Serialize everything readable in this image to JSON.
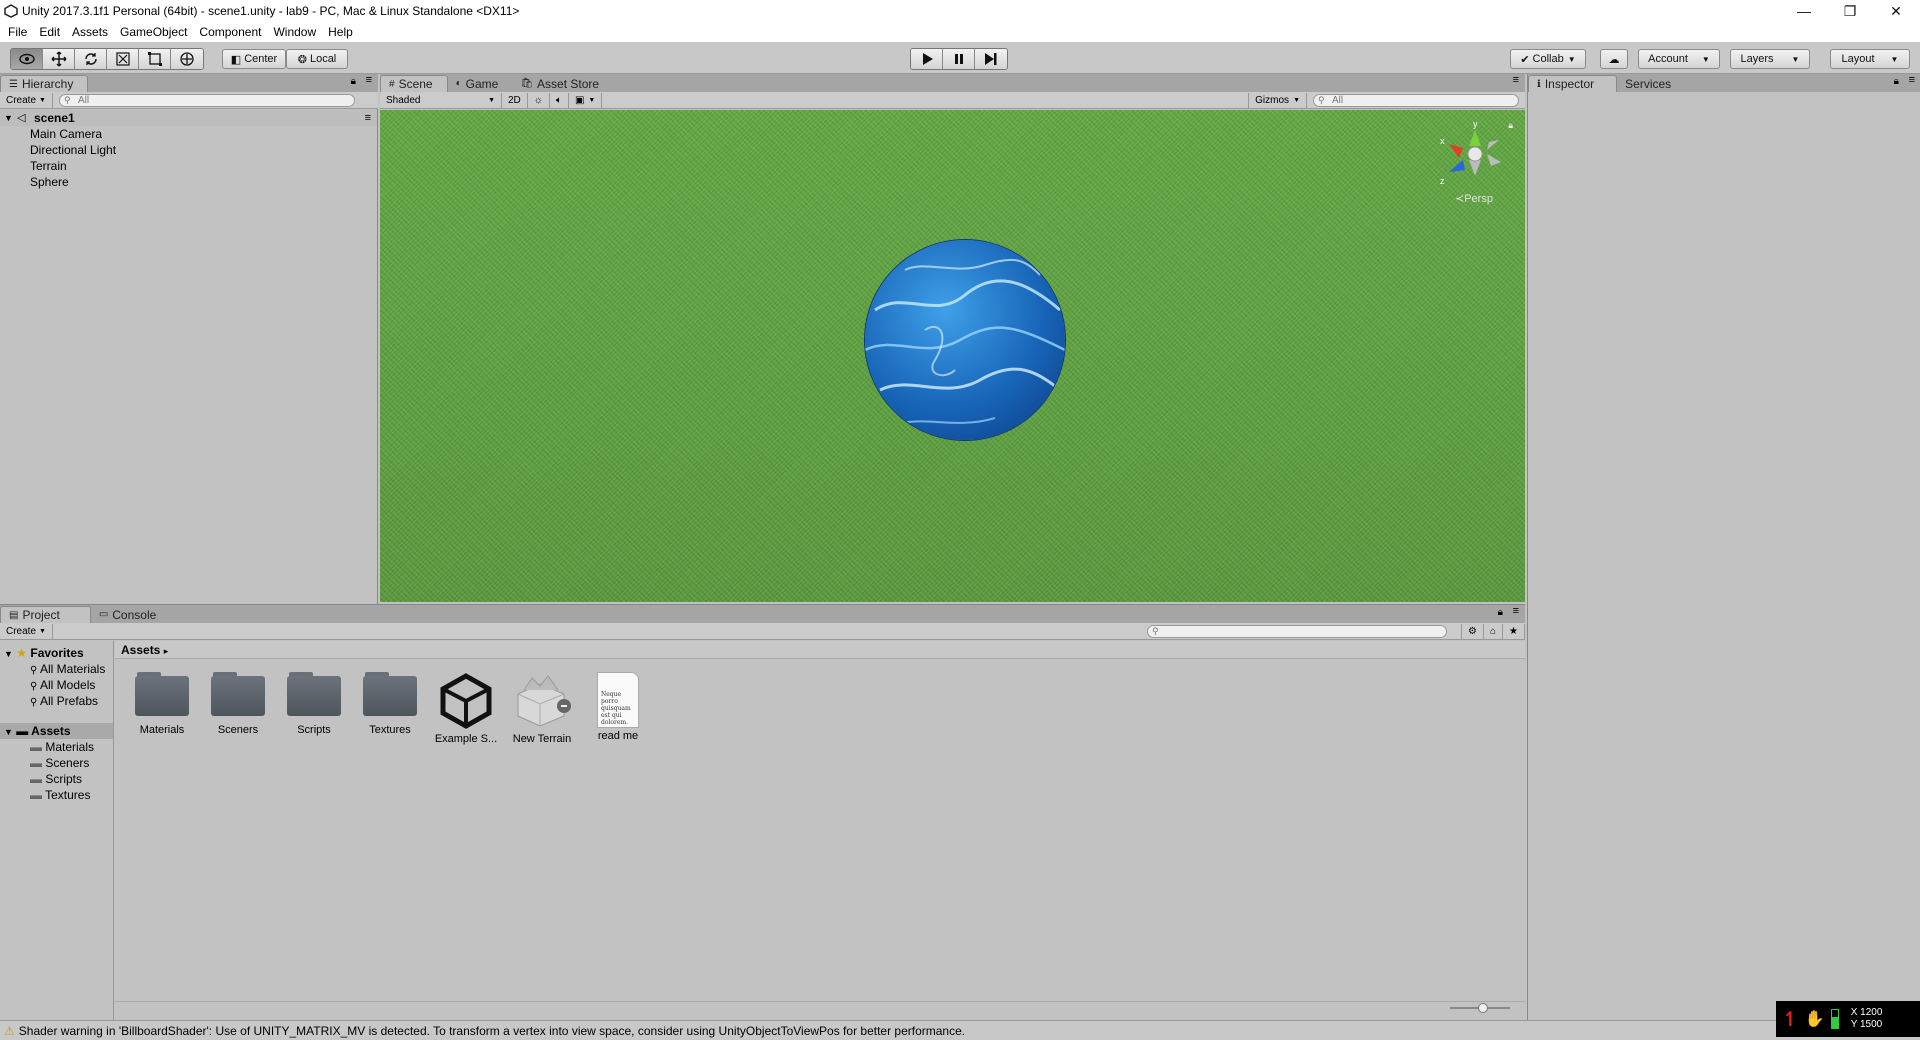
{
  "window": {
    "title": "Unity 2017.3.1f1 Personal (64bit) - scene1.unity - lab9 - PC, Mac & Linux Standalone <DX11>",
    "minimize": "—",
    "restore": "❐",
    "close": "✕"
  },
  "menu": [
    "File",
    "Edit",
    "Assets",
    "GameObject",
    "Component",
    "Window",
    "Help"
  ],
  "toolbar": {
    "pivot": "Center",
    "space": "Local",
    "collab": "Collab",
    "account": "Account",
    "layers": "Layers",
    "layout": "Layout"
  },
  "hierarchy": {
    "tab": "Hierarchy",
    "create": "Create",
    "search_placeholder": "All",
    "scene": "scene1",
    "items": [
      "Main Camera",
      "Directional Light",
      "Terrain",
      "Sphere"
    ]
  },
  "scene_tabs": {
    "scene": "Scene",
    "game": "Game",
    "store": "Asset Store"
  },
  "scene_bar": {
    "shading": "Shaded",
    "mode2d": "2D",
    "gizmos": "Gizmos",
    "search_placeholder": "All",
    "persp": "Persp",
    "axis_x": "x",
    "axis_y": "y",
    "axis_z": "z"
  },
  "inspector": {
    "tab": "Inspector",
    "services": "Services"
  },
  "project": {
    "tab": "Project",
    "console": "Console",
    "create": "Create",
    "favorites": "Favorites",
    "fav_items": [
      "All Materials",
      "All Models",
      "All Prefabs"
    ],
    "assets_root": "Assets",
    "asset_folders": [
      "Materials",
      "Sceners",
      "Scripts",
      "Textures"
    ],
    "breadcrumb": "Assets",
    "grid": [
      {
        "name": "Materials",
        "type": "folder"
      },
      {
        "name": "Sceners",
        "type": "folder"
      },
      {
        "name": "Scripts",
        "type": "folder"
      },
      {
        "name": "Textures",
        "type": "folder"
      },
      {
        "name": "Example S...",
        "type": "unity-scene"
      },
      {
        "name": "New Terrain",
        "type": "terrain"
      },
      {
        "name": "read me",
        "type": "text",
        "preview": "Neque porro quisquam est qui dolorem."
      }
    ]
  },
  "status": {
    "message": "Shader warning in 'BillboardShader': Use of UNITY_MATRIX_MV is detected. To transform a vertex into view space, consider using UnityObjectToViewPos for better performance.",
    "x": "X 1200",
    "y": "Y 1500"
  }
}
